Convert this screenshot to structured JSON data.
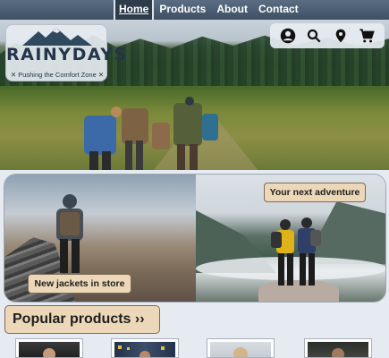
{
  "nav": {
    "links": [
      {
        "label": "Home",
        "active": true
      },
      {
        "label": "Products",
        "active": false
      },
      {
        "label": "About",
        "active": false
      },
      {
        "label": "Contact",
        "active": false
      }
    ]
  },
  "logo": {
    "title": "RAINYDAYS",
    "tagline": "✕ Pushing the Comfort Zone ✕"
  },
  "icons": [
    "user-icon",
    "search-icon",
    "location-pin-icon",
    "cart-icon"
  ],
  "promo": {
    "left_button": "New jackets in store",
    "right_button": "Your next adventure"
  },
  "popular": {
    "label": "Popular products ››"
  },
  "colors": {
    "nav_bg": "#3f5064",
    "accent_button": "#ecd8b8",
    "page_bg": "#e6ebf1",
    "logo_text": "#24344a"
  }
}
